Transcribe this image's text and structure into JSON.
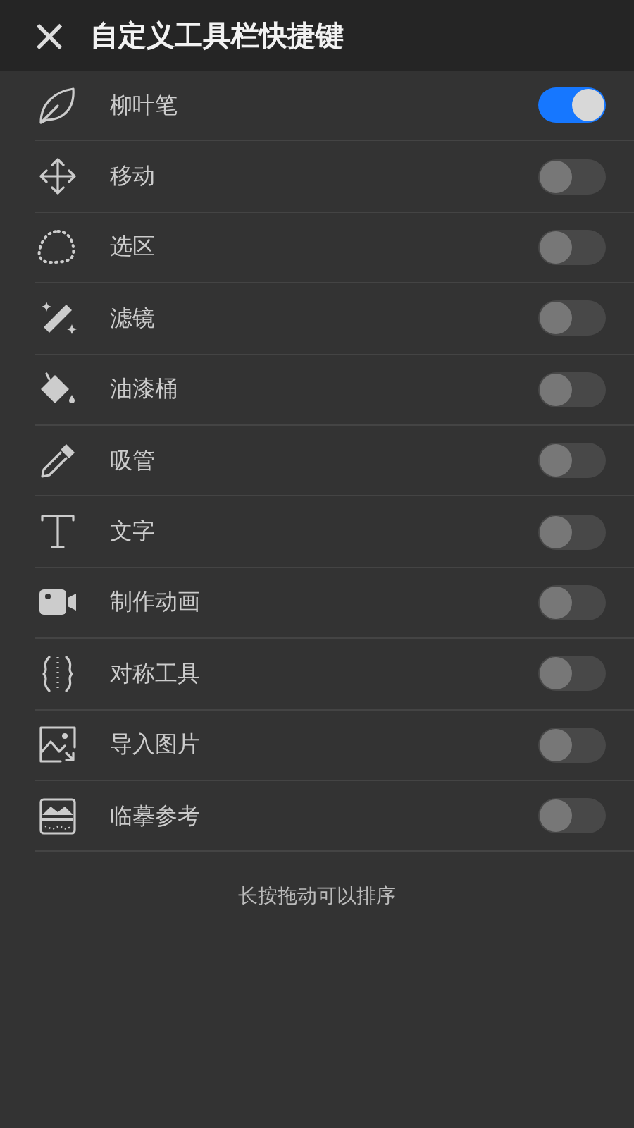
{
  "header": {
    "close": "×",
    "title": "自定义工具栏快捷键"
  },
  "tools": [
    {
      "label": "柳叶笔",
      "on": true
    },
    {
      "label": "移动",
      "on": false
    },
    {
      "label": "选区",
      "on": false
    },
    {
      "label": "滤镜",
      "on": false
    },
    {
      "label": "油漆桶",
      "on": false
    },
    {
      "label": "吸管",
      "on": false
    },
    {
      "label": "文字",
      "on": false
    },
    {
      "label": "制作动画",
      "on": false
    },
    {
      "label": "对称工具",
      "on": false
    },
    {
      "label": "导入图片",
      "on": false
    },
    {
      "label": "临摹参考",
      "on": false
    }
  ],
  "hint": "长按拖动可以排序"
}
